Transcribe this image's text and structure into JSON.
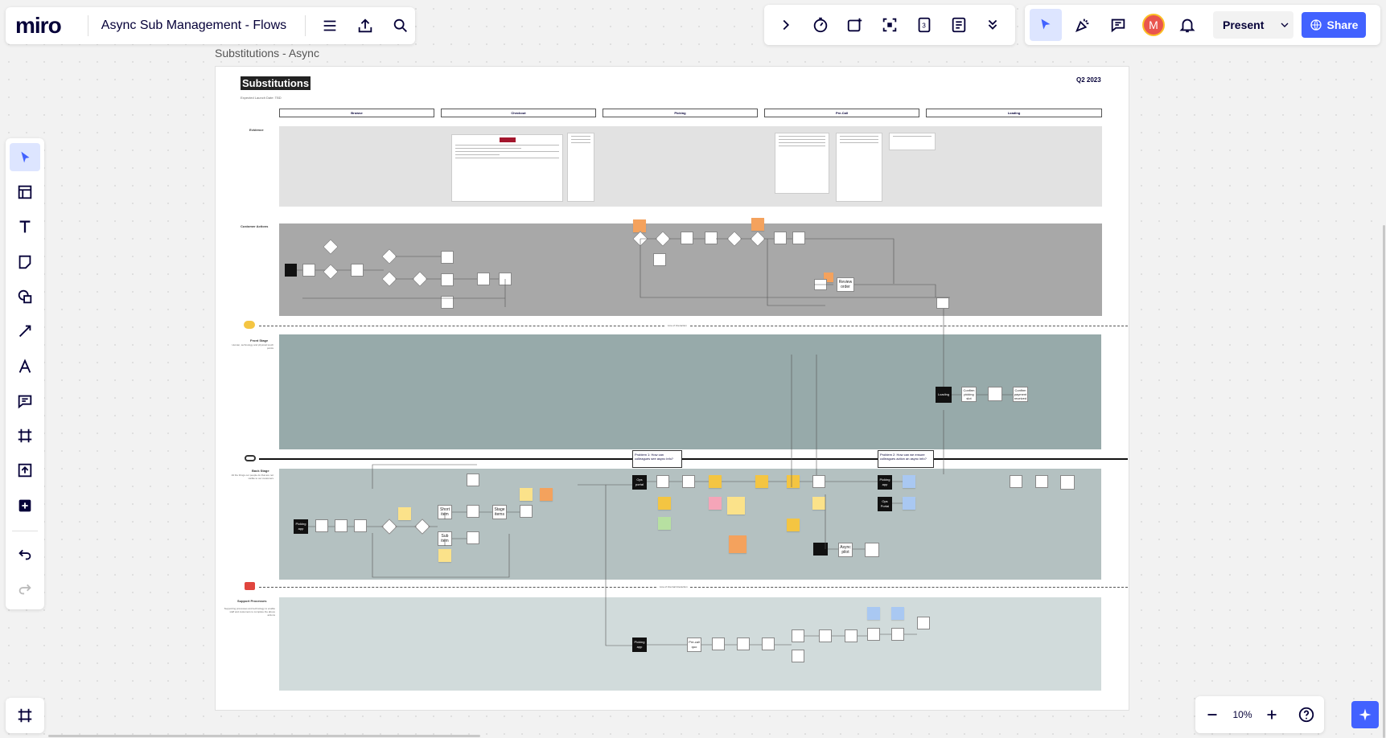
{
  "app": {
    "logo": "miro",
    "board_name": "Async Sub Management - Flows"
  },
  "top_left_toolbar": {
    "menu_icon": "hamburger-menu-icon",
    "export_icon": "upload-icon",
    "search_icon": "search-icon"
  },
  "top_right_toolbar": {
    "tools": [
      "chevron-right-icon",
      "timer-icon",
      "card-icon",
      "focus-icon",
      "counter-icon",
      "notes-icon",
      "more-chevron-icon"
    ]
  },
  "collab_toolbar": {
    "avatar_initial": "M",
    "avatar_color": "#e9554d",
    "present_label": "Present",
    "share_label": "Share",
    "share_color": "#4262ff"
  },
  "left_toolbar": {
    "tools": [
      "select-cursor-icon",
      "template-icon",
      "text-icon",
      "sticky-note-icon",
      "shapes-icon",
      "line-icon",
      "pen-icon",
      "comment-icon",
      "frame-icon",
      "upload-icon",
      "add-icon"
    ],
    "undo_icon": "undo-icon",
    "redo_icon": "redo-icon"
  },
  "frames_button": {
    "icon": "frames-icon"
  },
  "zoom": {
    "value": "10%",
    "zoom_out_icon": "minus-icon",
    "zoom_in_icon": "plus-icon",
    "help_icon": "help-icon",
    "assist_icon": "sparkle-icon"
  },
  "board": {
    "frame_title": "Substitutions - Async",
    "heading": "Substitutions",
    "subheading": "Expected Launch Date: TBD",
    "quarter": "Q2 2023",
    "columns": [
      "Browse",
      "Checkout",
      "Picking",
      "Pre-Call",
      "Loading"
    ],
    "lanes": {
      "evidence": "Evidence",
      "customer_actions": "Customer Actions",
      "front_stage": "Front Stage",
      "front_stage_desc": "Human, technology and physical touch points",
      "back_stage": "Back Stage",
      "back_stage_desc": "All the things our people do that are not visible to our customers",
      "support": "Support Processes",
      "support_desc": "Supporting processes and technology to enable staff and customers to complete the above actions"
    },
    "line_of_interaction": "Line of Interaction",
    "line_of_internal_interaction": "Line of Internal Interaction",
    "problem_1": "Problem 1: How can colleagues see async info?",
    "problem_2": "Problem 2: How can we ensure colleagues action an async info?",
    "nodes": {
      "review_order": "Review order",
      "loading": "Loading",
      "confirm_picking_slot": "Confirm picking slot",
      "confirm_payment": "Confirm payment received",
      "ops_portal": "Ops portal",
      "picking_app": "Picking app",
      "ops_portal_2": "Ops Portal",
      "short_item": "Short item",
      "sub_item": "Sub item",
      "stage_items": "Stage items",
      "async_pilot": "Async pilot",
      "picking_app_support": "Picking app",
      "pre_call_quo": "Pre-call quo"
    }
  }
}
